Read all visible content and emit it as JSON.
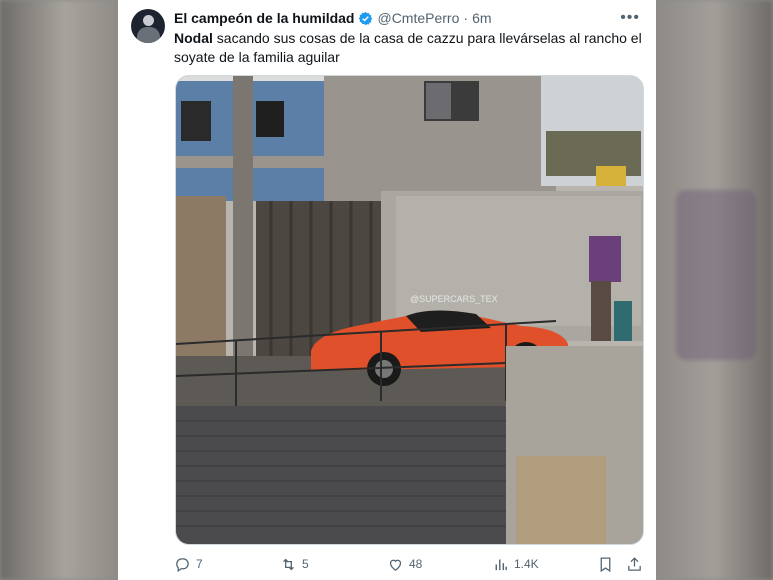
{
  "tweet": {
    "display_name": "El campeón de la humildad",
    "handle": "@CmtePerro",
    "separator": "·",
    "time": "6m",
    "text_bold": "Nodal",
    "text_rest": " sacando sus cosas de la casa de cazzu para llevárselas al rancho el soyate de la familia aguilar",
    "media_watermark": "@SUPERCARS_TEX",
    "actions": {
      "replies": "7",
      "reposts": "5",
      "likes": "48",
      "views": "1.4K"
    }
  },
  "icons": {
    "avatar": "profile-avatar",
    "verified": "verified-badge-icon",
    "more": "more-options-icon",
    "reply": "reply-icon",
    "repost": "repost-icon",
    "like": "heart-icon",
    "views": "views-chart-icon",
    "bookmark": "bookmark-icon",
    "share": "share-icon"
  },
  "colors": {
    "accent": "#1d9bf0",
    "text": "#0f1419",
    "muted": "#536471",
    "car": "#e0502a"
  }
}
